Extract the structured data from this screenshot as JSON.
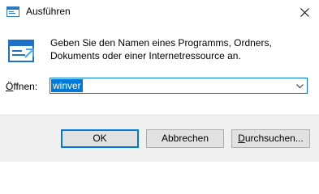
{
  "window": {
    "title": "Ausführen",
    "close_tooltip_icon": "close-icon"
  },
  "content": {
    "description": "Geben Sie den Namen eines Programms, Ordners,\nDokuments oder einer Internetressource an.",
    "open_label_prefix": "Ö",
    "open_label_rest": "ffnen:",
    "open_value": "winver"
  },
  "buttons": {
    "ok": "OK",
    "cancel": "Abbrechen",
    "browse_prefix": "D",
    "browse_rest": "urchsuchen..."
  },
  "colors": {
    "accent": "#0078d7",
    "footer": "#f0f0f0",
    "button": "#e1e1e1"
  },
  "icons": [
    "run-dialog-icon",
    "close-icon",
    "chevron-down-icon"
  ]
}
